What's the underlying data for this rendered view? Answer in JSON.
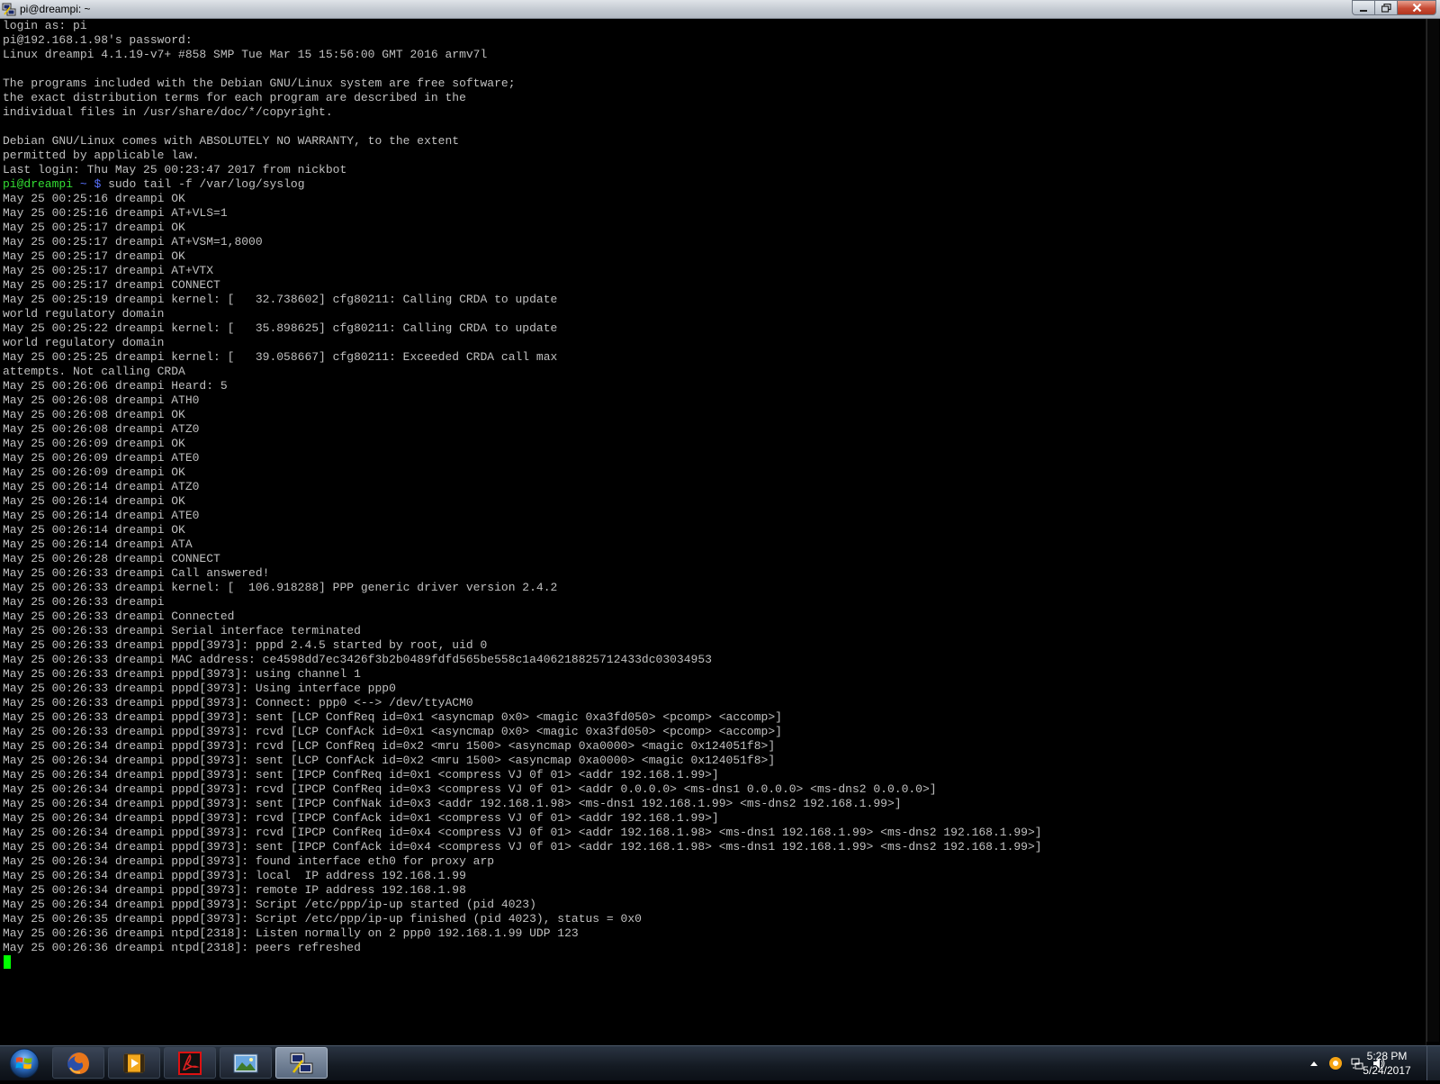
{
  "window": {
    "title": "pi@dreampi: ~"
  },
  "terminal": {
    "prompt_user": "pi@dreampi",
    "prompt_path": "~",
    "prompt_symbol": "$",
    "command": "sudo tail -f /var/log/syslog",
    "lines_before": [
      "login as: pi",
      "pi@192.168.1.98's password:",
      "Linux dreampi 4.1.19-v7+ #858 SMP Tue Mar 15 15:56:00 GMT 2016 armv7l",
      "",
      "The programs included with the Debian GNU/Linux system are free software;",
      "the exact distribution terms for each program are described in the",
      "individual files in /usr/share/doc/*/copyright.",
      "",
      "Debian GNU/Linux comes with ABSOLUTELY NO WARRANTY, to the extent",
      "permitted by applicable law.",
      "Last login: Thu May 25 00:23:47 2017 from nickbot"
    ],
    "lines_after": [
      "May 25 00:25:16 dreampi OK",
      "May 25 00:25:16 dreampi AT+VLS=1",
      "May 25 00:25:17 dreampi OK",
      "May 25 00:25:17 dreampi AT+VSM=1,8000",
      "May 25 00:25:17 dreampi OK",
      "May 25 00:25:17 dreampi AT+VTX",
      "May 25 00:25:17 dreampi CONNECT",
      "May 25 00:25:19 dreampi kernel: [   32.738602] cfg80211: Calling CRDA to update",
      "world regulatory domain",
      "May 25 00:25:22 dreampi kernel: [   35.898625] cfg80211: Calling CRDA to update",
      "world regulatory domain",
      "May 25 00:25:25 dreampi kernel: [   39.058667] cfg80211: Exceeded CRDA call max",
      "attempts. Not calling CRDA",
      "May 25 00:26:06 dreampi Heard: 5",
      "May 25 00:26:08 dreampi ATH0",
      "May 25 00:26:08 dreampi OK",
      "May 25 00:26:08 dreampi ATZ0",
      "May 25 00:26:09 dreampi OK",
      "May 25 00:26:09 dreampi ATE0",
      "May 25 00:26:09 dreampi OK",
      "May 25 00:26:14 dreampi ATZ0",
      "May 25 00:26:14 dreampi OK",
      "May 25 00:26:14 dreampi ATE0",
      "May 25 00:26:14 dreampi OK",
      "May 25 00:26:14 dreampi ATA",
      "May 25 00:26:28 dreampi CONNECT",
      "May 25 00:26:33 dreampi Call answered!",
      "May 25 00:26:33 dreampi kernel: [  106.918288] PPP generic driver version 2.4.2",
      "May 25 00:26:33 dreampi",
      "May 25 00:26:33 dreampi Connected",
      "May 25 00:26:33 dreampi Serial interface terminated",
      "May 25 00:26:33 dreampi pppd[3973]: pppd 2.4.5 started by root, uid 0",
      "May 25 00:26:33 dreampi MAC address: ce4598dd7ec3426f3b2b0489fdfd565be558c1a406218825712433dc03034953",
      "May 25 00:26:33 dreampi pppd[3973]: using channel 1",
      "May 25 00:26:33 dreampi pppd[3973]: Using interface ppp0",
      "May 25 00:26:33 dreampi pppd[3973]: Connect: ppp0 <--> /dev/ttyACM0",
      "May 25 00:26:33 dreampi pppd[3973]: sent [LCP ConfReq id=0x1 <asyncmap 0x0> <magic 0xa3fd050> <pcomp> <accomp>]",
      "May 25 00:26:33 dreampi pppd[3973]: rcvd [LCP ConfAck id=0x1 <asyncmap 0x0> <magic 0xa3fd050> <pcomp> <accomp>]",
      "May 25 00:26:34 dreampi pppd[3973]: rcvd [LCP ConfReq id=0x2 <mru 1500> <asyncmap 0xa0000> <magic 0x124051f8>]",
      "May 25 00:26:34 dreampi pppd[3973]: sent [LCP ConfAck id=0x2 <mru 1500> <asyncmap 0xa0000> <magic 0x124051f8>]",
      "May 25 00:26:34 dreampi pppd[3973]: sent [IPCP ConfReq id=0x1 <compress VJ 0f 01> <addr 192.168.1.99>]",
      "May 25 00:26:34 dreampi pppd[3973]: rcvd [IPCP ConfReq id=0x3 <compress VJ 0f 01> <addr 0.0.0.0> <ms-dns1 0.0.0.0> <ms-dns2 0.0.0.0>]",
      "May 25 00:26:34 dreampi pppd[3973]: sent [IPCP ConfNak id=0x3 <addr 192.168.1.98> <ms-dns1 192.168.1.99> <ms-dns2 192.168.1.99>]",
      "May 25 00:26:34 dreampi pppd[3973]: rcvd [IPCP ConfAck id=0x1 <compress VJ 0f 01> <addr 192.168.1.99>]",
      "May 25 00:26:34 dreampi pppd[3973]: rcvd [IPCP ConfReq id=0x4 <compress VJ 0f 01> <addr 192.168.1.98> <ms-dns1 192.168.1.99> <ms-dns2 192.168.1.99>]",
      "May 25 00:26:34 dreampi pppd[3973]: sent [IPCP ConfAck id=0x4 <compress VJ 0f 01> <addr 192.168.1.98> <ms-dns1 192.168.1.99> <ms-dns2 192.168.1.99>]",
      "May 25 00:26:34 dreampi pppd[3973]: found interface eth0 for proxy arp",
      "May 25 00:26:34 dreampi pppd[3973]: local  IP address 192.168.1.99",
      "May 25 00:26:34 dreampi pppd[3973]: remote IP address 192.168.1.98",
      "May 25 00:26:34 dreampi pppd[3973]: Script /etc/ppp/ip-up started (pid 4023)",
      "May 25 00:26:35 dreampi pppd[3973]: Script /etc/ppp/ip-up finished (pid 4023), status = 0x0",
      "May 25 00:26:36 dreampi ntpd[2318]: Listen normally on 2 ppp0 192.168.1.99 UDP 123",
      "May 25 00:26:36 dreampi ntpd[2318]: peers refreshed"
    ]
  },
  "taskbar": {
    "apps": [
      {
        "name": "firefox-icon",
        "active": false
      },
      {
        "name": "media-player-icon",
        "active": false
      },
      {
        "name": "pdf-reader-icon",
        "active": false
      },
      {
        "name": "image-viewer-icon",
        "active": false
      },
      {
        "name": "putty-icon",
        "active": true
      }
    ],
    "clock": {
      "time": "5:28 PM",
      "date": "5/24/2017"
    }
  },
  "colors": {
    "terminal_bg": "#000000",
    "terminal_text": "#c0c0c0",
    "prompt_user": "#33dd33",
    "prompt_path": "#5a73ff",
    "cursor": "#00ff00"
  }
}
